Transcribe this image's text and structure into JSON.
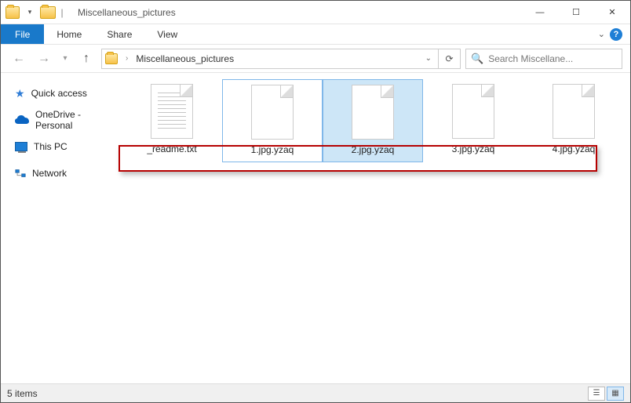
{
  "window": {
    "title": "Miscellaneous_pictures"
  },
  "ribbon": {
    "file": "File",
    "tabs": [
      "Home",
      "Share",
      "View"
    ]
  },
  "nav": {
    "breadcrumb": "Miscellaneous_pictures",
    "search_placeholder": "Search Miscellane..."
  },
  "sidebar": {
    "quick_access": "Quick access",
    "onedrive": "OneDrive - Personal",
    "this_pc": "This PC",
    "network": "Network"
  },
  "files": [
    {
      "name": "_readme.txt",
      "lined": true,
      "state": "normal"
    },
    {
      "name": "1.jpg.yzaq",
      "lined": false,
      "state": "selected-border"
    },
    {
      "name": "2.jpg.yzaq",
      "lined": false,
      "state": "selected-fill"
    },
    {
      "name": "3.jpg.yzaq",
      "lined": false,
      "state": "normal"
    },
    {
      "name": "4.jpg.yzaq",
      "lined": false,
      "state": "normal"
    }
  ],
  "status": {
    "count_text": "5 items"
  }
}
